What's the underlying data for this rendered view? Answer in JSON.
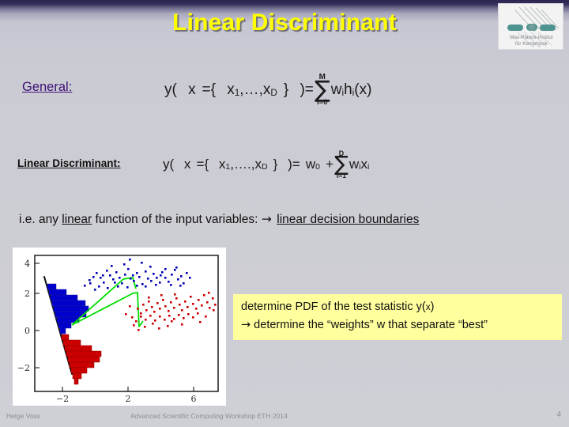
{
  "slide": {
    "title": "Linear Discriminant",
    "accent_yellow": "#ffff00",
    "callout_bg": "#ffff9e",
    "background": "#cdcdd4",
    "topbar_color": "#2b2550"
  },
  "logo": {
    "name": "max-planck-institut-logo",
    "line1": "Max-Planck-Institut",
    "line2": "für Kernphysik",
    "bg": "#f3f3f3",
    "mark_color": "#4e938f"
  },
  "sections": {
    "general": {
      "label": "General:",
      "label_color": "#3b1072",
      "formula": {
        "lhs_y": "y(",
        "lhs_x": "x",
        "eq_open": "={",
        "vars": "x",
        "var_sub_1": "1",
        "ellipsis": ",…,",
        "var_last": "x",
        "var_last_sub": "D",
        "brace_close": "}",
        "paren_close": ")",
        "equals": "=",
        "sum_upper": "M",
        "sum_symbol": "∑",
        "sum_lower": "i=0",
        "term_w": "w",
        "term_w_sub": "i",
        "term_h": "h",
        "term_h_sub": "i",
        "term_arg": "(x)"
      }
    },
    "linear_discriminant": {
      "label": "Linear Discriminant:",
      "label_color": "#111111",
      "formula": {
        "lhs_y": "y(",
        "lhs_x": "x",
        "eq_open": "={",
        "vars": "x",
        "var_sub_1": "1",
        "ellipsis": ",….,",
        "var_last": "x",
        "var_last_sub": "D",
        "brace_close": "}",
        "paren_close": ")",
        "equals": "=",
        "w_zero": "w",
        "w_zero_sub": "0",
        "plus": "+",
        "sum_upper": "D",
        "sum_symbol": "∑",
        "sum_lower": "i=1",
        "term_w": "w",
        "term_w_sub": "i",
        "term_x": "x",
        "term_x_sub": "i"
      }
    }
  },
  "ie_line": {
    "prefix": "i.e.  any ",
    "underlined_1": "linear",
    "middle": " function of the input variables:  ",
    "arrow": "→",
    "underlined_2": "linear decision boundaries"
  },
  "callout": {
    "line1": "determine PDF of the test statistic y(x)",
    "line1_main": "determine PDF of the test statistic y(",
    "line1_x": "x",
    "line1_end": ")",
    "arrow": "→",
    "line2": " determine the “weights” w that separate “best”"
  },
  "footer": {
    "author": "Helge Voss",
    "center": "Advanced Scientific Computing Workshop ETH 2014",
    "page": "4"
  },
  "chart_data": {
    "type": "scatter",
    "title": "",
    "xlabel": "",
    "ylabel": "",
    "xlim": [
      -3.6,
      7.6
    ],
    "ylim": [
      -2.9,
      4.9
    ],
    "xticks": [
      -2,
      2,
      6
    ],
    "yticks": [
      4,
      2,
      0,
      -2
    ],
    "grid": false,
    "legend": null,
    "series": [
      {
        "name": "class-blue",
        "color": "#0000b4",
        "marker": "square",
        "points": [
          [
            -0.3,
            2.66
          ],
          [
            -0.1,
            2.93
          ],
          [
            0.05,
            3.1
          ],
          [
            0.2,
            3.32
          ],
          [
            0.35,
            3.05
          ],
          [
            0.5,
            2.82
          ],
          [
            0.62,
            3.45
          ],
          [
            0.75,
            3.18
          ],
          [
            0.88,
            2.95
          ],
          [
            1.0,
            3.36
          ],
          [
            1.12,
            3.08
          ],
          [
            1.25,
            2.78
          ],
          [
            1.38,
            3.24
          ],
          [
            1.5,
            3.52
          ],
          [
            1.62,
            3.01
          ],
          [
            1.75,
            2.88
          ],
          [
            1.88,
            3.3
          ],
          [
            2.0,
            3.12
          ],
          [
            2.12,
            2.74
          ],
          [
            2.25,
            3.4
          ],
          [
            2.38,
            3.02
          ],
          [
            2.5,
            2.9
          ],
          [
            2.62,
            3.26
          ],
          [
            2.75,
            3.08
          ],
          [
            2.88,
            2.8
          ],
          [
            3.0,
            3.34
          ],
          [
            3.15,
            3.06
          ],
          [
            3.3,
            2.86
          ],
          [
            3.45,
            3.22
          ],
          [
            3.6,
            3.48
          ],
          [
            3.75,
            2.96
          ],
          [
            3.9,
            3.14
          ],
          [
            4.05,
            2.76
          ],
          [
            4.2,
            3.28
          ],
          [
            4.35,
            3.04
          ],
          [
            0.45,
            2.6
          ],
          [
            0.95,
            2.55
          ],
          [
            1.55,
            2.62
          ],
          [
            2.15,
            2.58
          ],
          [
            2.7,
            2.66
          ],
          [
            3.2,
            2.6
          ],
          [
            3.8,
            2.7
          ],
          [
            4.4,
            3.52
          ],
          [
            3.05,
            3.92
          ],
          [
            2.35,
            4.1
          ],
          [
            4.55,
            3.62
          ],
          [
            1.05,
            3.72
          ],
          [
            0.15,
            2.45
          ],
          [
            1.95,
            3.78
          ],
          [
            3.55,
            3.68
          ]
        ]
      },
      {
        "name": "class-red",
        "color": "#cc0000",
        "marker": "square",
        "points": [
          [
            2.55,
            1.38
          ],
          [
            2.7,
            1.12
          ],
          [
            2.85,
            1.6
          ],
          [
            3.0,
            1.3
          ],
          [
            3.15,
            1.78
          ],
          [
            3.3,
            1.45
          ],
          [
            3.45,
            1.18
          ],
          [
            3.6,
            1.68
          ],
          [
            3.75,
            1.4
          ],
          [
            3.9,
            1.85
          ],
          [
            4.05,
            1.52
          ],
          [
            4.2,
            1.25
          ],
          [
            4.35,
            1.72
          ],
          [
            4.5,
            1.44
          ],
          [
            4.65,
            1.95
          ],
          [
            4.8,
            1.6
          ],
          [
            4.95,
            1.32
          ],
          [
            5.1,
            1.8
          ],
          [
            5.25,
            1.5
          ],
          [
            5.4,
            2.05
          ],
          [
            5.55,
            1.7
          ],
          [
            5.7,
            1.4
          ],
          [
            5.85,
            1.88
          ],
          [
            6.0,
            1.58
          ],
          [
            6.15,
            2.12
          ],
          [
            6.3,
            1.76
          ],
          [
            6.45,
            1.46
          ],
          [
            6.6,
            1.94
          ],
          [
            6.75,
            1.64
          ],
          [
            6.9,
            2.22
          ],
          [
            2.35,
            0.92
          ],
          [
            2.6,
            0.7
          ],
          [
            2.9,
            1.02
          ],
          [
            3.2,
            0.82
          ],
          [
            3.5,
            1.08
          ],
          [
            3.8,
            0.74
          ],
          [
            4.1,
            1.0
          ],
          [
            4.4,
            0.8
          ],
          [
            4.7,
            1.06
          ],
          [
            5.0,
            0.88
          ],
          [
            5.3,
            1.14
          ],
          [
            5.6,
            0.94
          ],
          [
            5.9,
            1.2
          ],
          [
            6.2,
            1.0
          ],
          [
            6.5,
            1.26
          ],
          [
            2.2,
            1.5
          ],
          [
            1.95,
            1.2
          ],
          [
            7.3,
            1.42
          ],
          [
            6.8,
            2.4
          ],
          [
            5.05,
            2.3
          ],
          [
            4.15,
            2.28
          ],
          [
            3.35,
            2.02
          ],
          [
            4.6,
            0.52
          ],
          [
            5.5,
            0.62
          ],
          [
            3.05,
            0.46
          ]
        ]
      }
    ],
    "projection_axis": {
      "name": "projection-direction",
      "color": "#000000",
      "from": [
        -3.0,
        3.0
      ],
      "to": [
        -1.3,
        -1.9
      ]
    },
    "histograms": [
      {
        "name": "blue-projected-histogram",
        "color": "#0000cc",
        "direction": "perpendicular-right",
        "bins": [
          0.18,
          0.42,
          0.72,
          0.95,
          1.0,
          0.88,
          0.62,
          0.34,
          0.14
        ]
      },
      {
        "name": "red-projected-histogram",
        "color": "#cc0000",
        "direction": "perpendicular-right",
        "bins": [
          0.2,
          0.48,
          0.78,
          1.0,
          0.92,
          0.7,
          0.46,
          0.26,
          0.1
        ]
      }
    ],
    "separation_lines": {
      "name": "decision-boundary-lines",
      "color": "#00dd00",
      "polyline": [
        [
          -2.45,
          0.62
        ],
        [
          2.05,
          2.12
        ],
        [
          2.35,
          1.12
        ],
        [
          3.35,
          1.45
        ]
      ],
      "polyline2": [
        [
          -2.45,
          0.62
        ],
        [
          1.95,
          3.35
        ],
        [
          2.3,
          3.3
        ],
        [
          2.45,
          1.2
        ]
      ]
    }
  }
}
